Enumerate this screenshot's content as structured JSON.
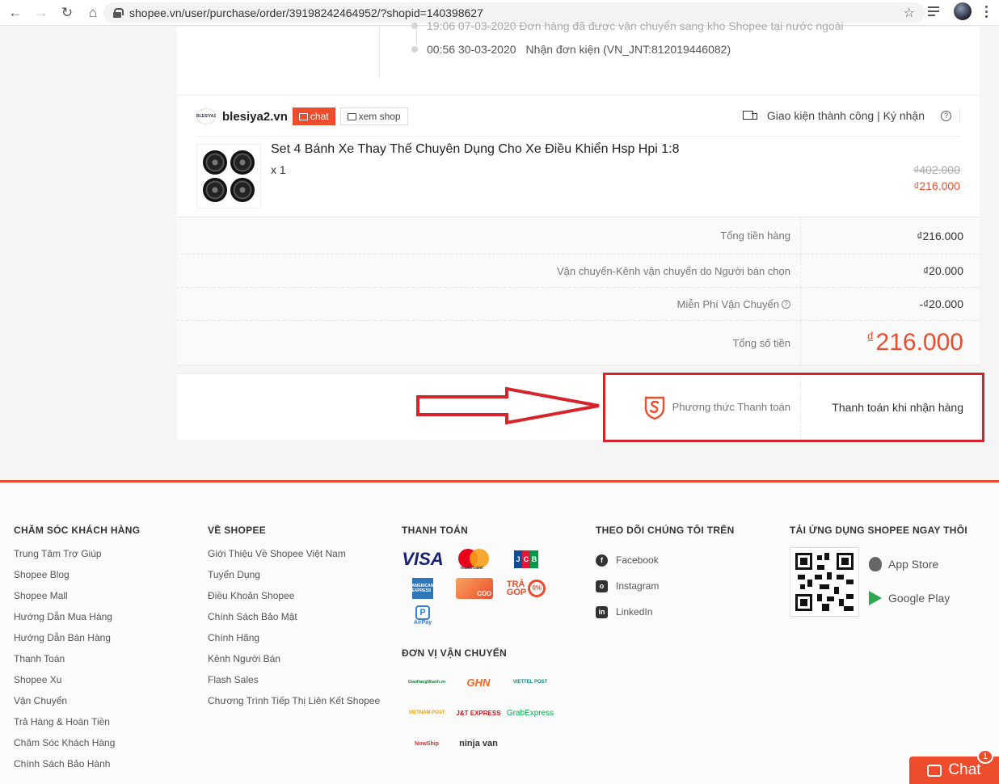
{
  "browser": {
    "url": "shopee.vn/user/purchase/order/39198242464952/?shopid=140398627"
  },
  "tracking": {
    "faded_row": "19:06 07-03-2020  Đơn hàng đã được vận chuyển sang kho Shopee tại nước ngoài",
    "last_time": "00:56 30-03-2020",
    "last_text": "Nhận đơn kiện (VN_JNT:812019446082)"
  },
  "shop": {
    "logo_text": "BLESIYA2",
    "name": "blesiya2.vn",
    "chat_label": "chat",
    "view_shop_label": "xem shop",
    "delivery_status": "Giao kiện thành công | Ký nhận"
  },
  "product": {
    "name": "Set 4 Bánh Xe Thay Thế Chuyên Dụng Cho Xe Điều Khiển Hsp Hpi 1:8",
    "quantity": "x 1",
    "price_original": "₫402.000",
    "price_sale": "₫216.000"
  },
  "summary": {
    "rows": [
      {
        "label": "Tổng tiền hàng",
        "value": "₫216.000"
      },
      {
        "label": "Vận chuyển-Kênh vận chuyển do Người bán chọn",
        "value": "₫20.000"
      },
      {
        "label": "Miễn Phí Vận Chuyển",
        "value": "-₫20.000"
      }
    ],
    "total_label": "Tổng số tiền",
    "total_currency": "₫",
    "total_value": "216.000"
  },
  "payment": {
    "label": "Phương thức Thanh toán",
    "value": "Thanh toán khi nhận hàng"
  },
  "footer": {
    "customer_care": {
      "title": "CHĂM SÓC KHÁCH HÀNG",
      "items": [
        "Trung Tâm Trợ Giúp",
        "Shopee Blog",
        "Shopee Mall",
        "Hướng Dẫn Mua Hàng",
        "Hướng Dẫn Bán Hàng",
        "Thanh Toán",
        "Shopee Xu",
        "Vận Chuyển",
        "Trả Hàng & Hoàn Tiền",
        "Chăm Sóc Khách Hàng",
        "Chính Sách Bảo Hành"
      ]
    },
    "about": {
      "title": "VỀ SHOPEE",
      "items": [
        "Giới Thiệu Về Shopee Việt Nam",
        "Tuyển Dụng",
        "Điều Khoản Shopee",
        "Chính Sách Bảo Mật",
        "Chính Hãng",
        "Kênh Người Bán",
        "Flash Sales",
        "Chương Trình Tiếp Thị Liên Kết Shopee"
      ]
    },
    "payment": {
      "title": "THANH TOÁN",
      "visa": "VISA",
      "mastercard": "mastercard",
      "jcb": [
        "J",
        "C",
        "B"
      ],
      "amex": "AMERICAN EXPRESS",
      "cod": "COD",
      "tragop_line1": "TRẢ",
      "tragop_line2": "GÓP",
      "tragop_pct": "0%",
      "airpay": "AirPay"
    },
    "shipping": {
      "title": "ĐƠN VỊ VẬN CHUYỂN",
      "carriers": [
        "GiaoHangNhanh.vn",
        "GHN",
        "VIETTEL POST",
        "VIETNAM POST",
        "J&T EXPRESS",
        "GrabExpress",
        "NowShip",
        "ninja van"
      ]
    },
    "follow": {
      "title": "THEO DÕI CHÚNG TÔI TRÊN",
      "items": [
        "Facebook",
        "Instagram",
        "LinkedIn"
      ]
    },
    "app": {
      "title": "TẢI ỨNG DỤNG SHOPEE NGAY THÔI",
      "app_store": "App Store",
      "google_play": "Google Play"
    }
  },
  "chat_widget": {
    "label": "Chat",
    "badge": "1"
  },
  "colors": {
    "brand": "#ee4d2d",
    "annotation_red": "#d7232b"
  }
}
